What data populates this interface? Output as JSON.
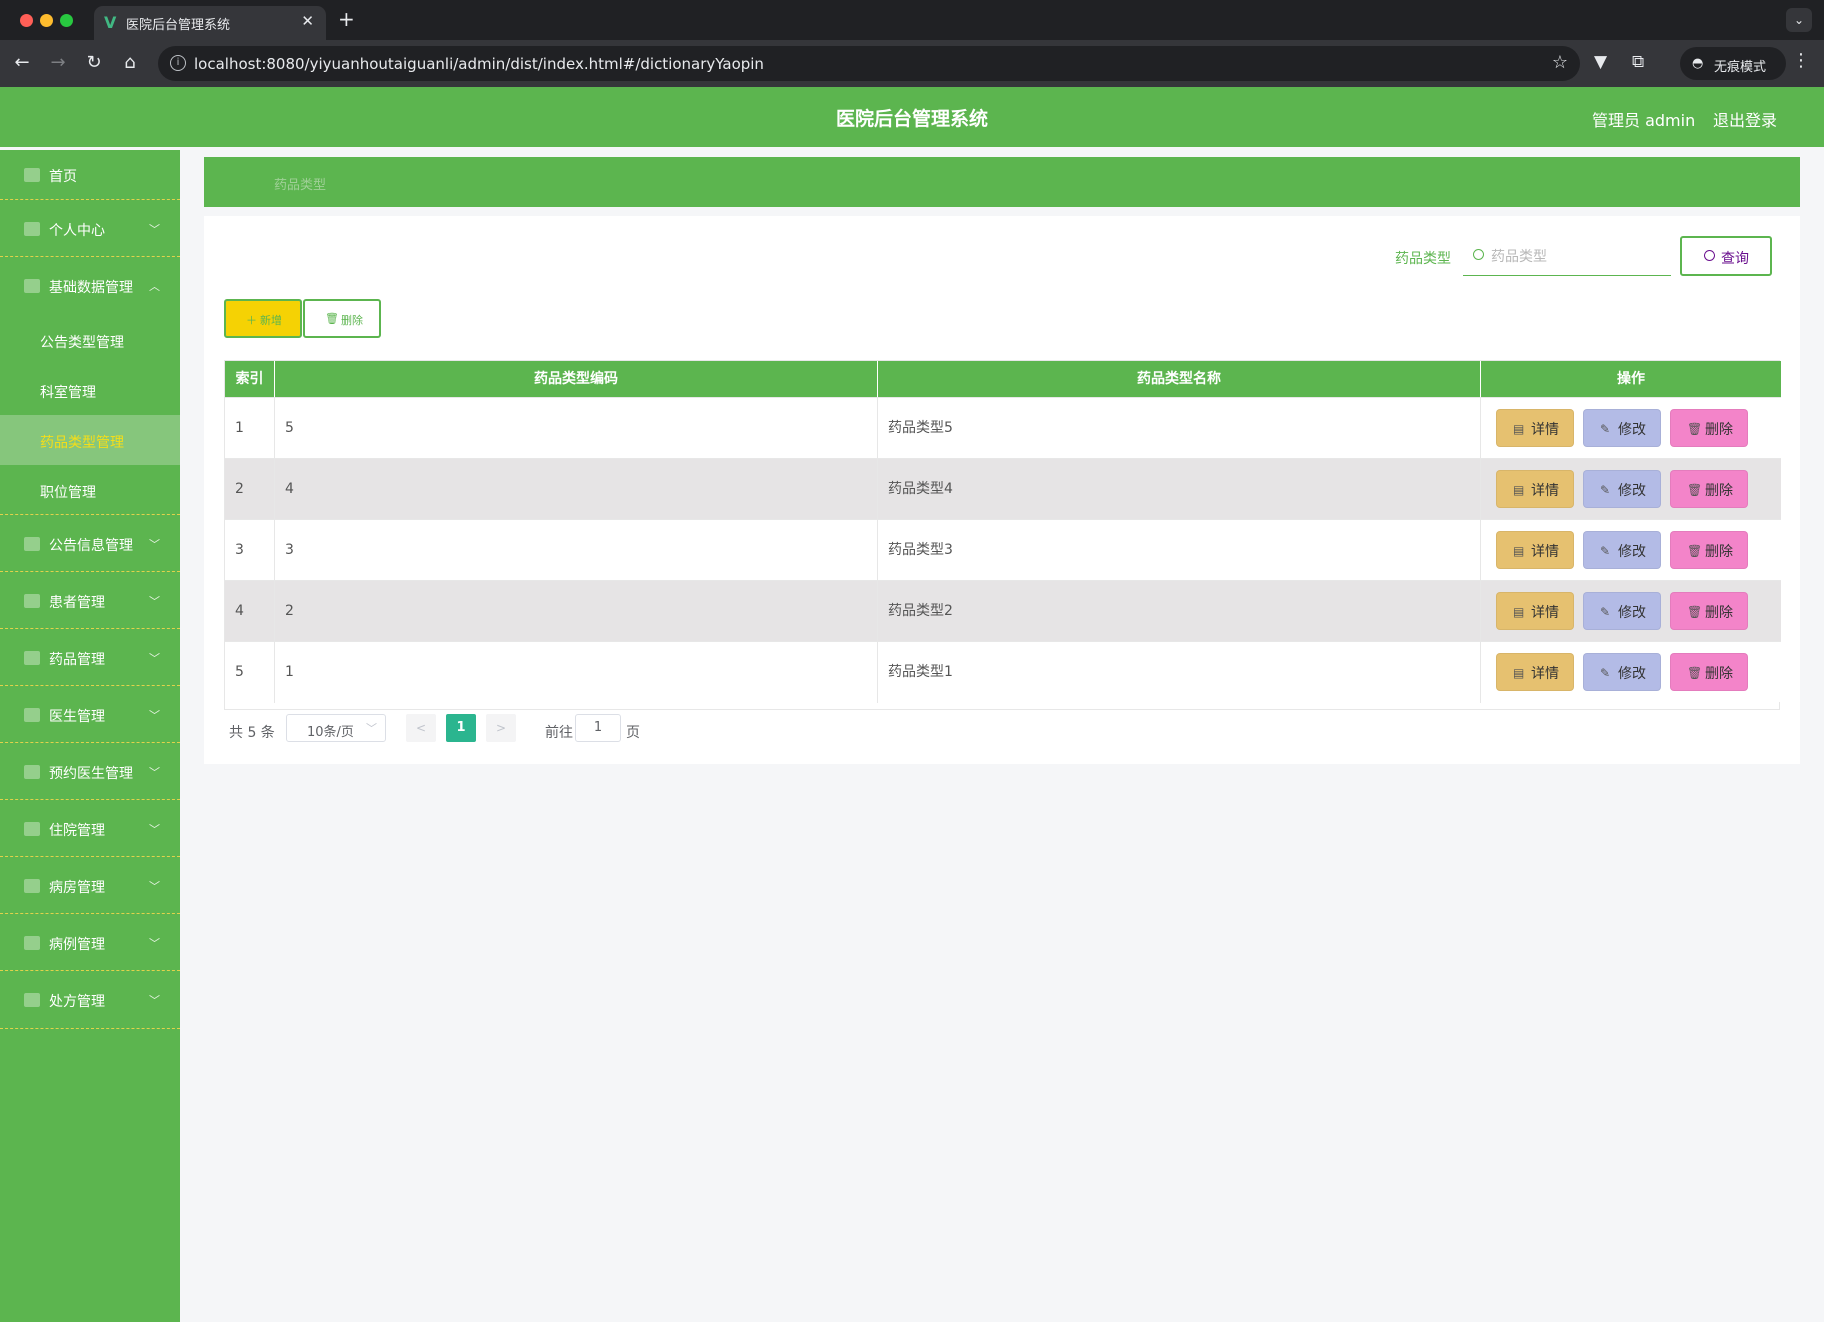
{
  "browser": {
    "tab_title": "医院后台管理系统",
    "url": "localhost:8080/yiyuanhoutaiguanli/admin/dist/index.html#/dictionaryYaopin",
    "incognito_label": "无痕模式"
  },
  "header": {
    "title": "医院后台管理系统",
    "user": "管理员 admin",
    "logout": "退出登录"
  },
  "sidebar": {
    "items": [
      {
        "label": "首页"
      },
      {
        "label": "个人中心"
      },
      {
        "label": "基础数据管理"
      },
      {
        "label": "公告信息管理"
      },
      {
        "label": "患者管理"
      },
      {
        "label": "药品管理"
      },
      {
        "label": "医生管理"
      },
      {
        "label": "预约医生管理"
      },
      {
        "label": "住院管理"
      },
      {
        "label": "病房管理"
      },
      {
        "label": "病例管理"
      },
      {
        "label": "处方管理"
      }
    ],
    "subitems": [
      {
        "label": "公告类型管理"
      },
      {
        "label": "科室管理"
      },
      {
        "label": "药品类型管理"
      },
      {
        "label": "职位管理"
      }
    ]
  },
  "breadcrumb": {
    "current": "药品类型"
  },
  "search": {
    "label": "药品类型",
    "placeholder": "药品类型",
    "button": "查询"
  },
  "actions": {
    "add": "新增",
    "delete": "删除"
  },
  "table": {
    "columns": [
      "索引",
      "药品类型编码",
      "药品类型名称",
      "操作"
    ],
    "rows": [
      {
        "index": "1",
        "code": "5",
        "name": "药品类型5"
      },
      {
        "index": "2",
        "code": "4",
        "name": "药品类型4"
      },
      {
        "index": "3",
        "code": "3",
        "name": "药品类型3"
      },
      {
        "index": "4",
        "code": "2",
        "name": "药品类型2"
      },
      {
        "index": "5",
        "code": "1",
        "name": "药品类型1"
      }
    ],
    "row_actions": {
      "detail": "详情",
      "edit": "修改",
      "delete": "删除"
    }
  },
  "pagination": {
    "total": "共 5 条",
    "page_size": "10条/页",
    "current_page": "1",
    "goto_prefix": "前往",
    "goto_value": "1",
    "goto_suffix": "页"
  },
  "colors": {
    "primary_green": "#5cb54f",
    "add_yellow": "#f5d204",
    "detail": "#e6c170",
    "edit": "#b3bbe6",
    "delete": "#f384c9",
    "pager_active": "#2bb58f"
  }
}
